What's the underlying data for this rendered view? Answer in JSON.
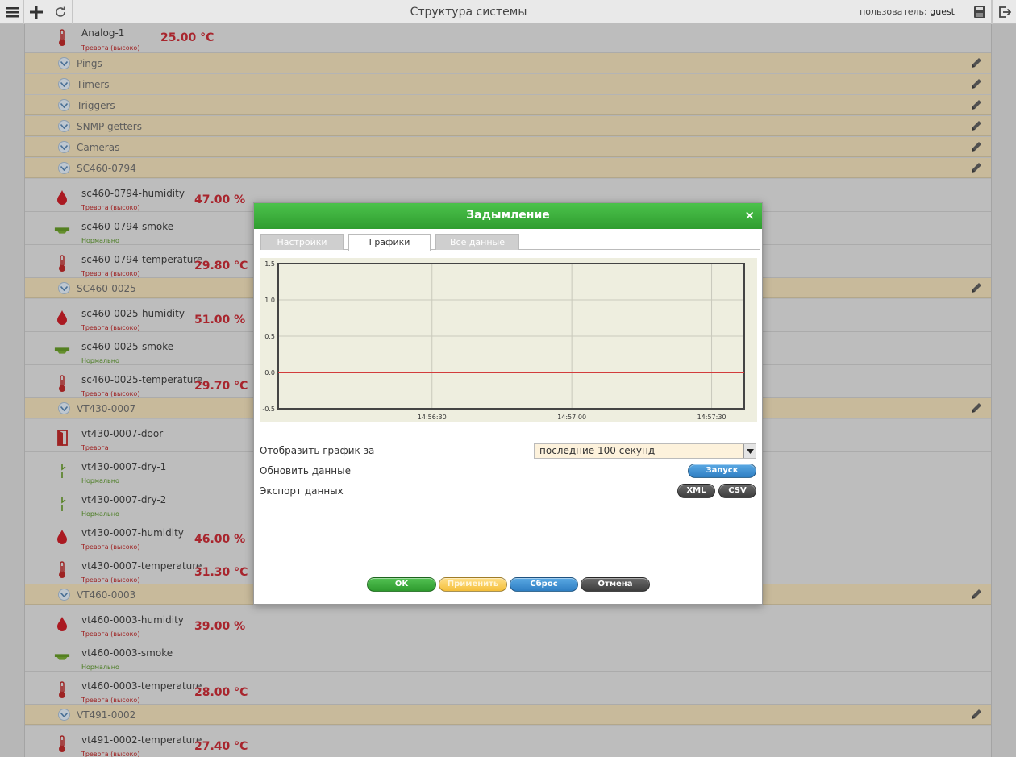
{
  "topbar": {
    "title": "Структура системы",
    "user_label": "пользователь:",
    "user_name": "guest"
  },
  "list": [
    {
      "kind": "sensor",
      "icon": "thermometer-icon",
      "name": "Analog-1",
      "state": "Тревога (высоко)",
      "state_kind": "alarm",
      "value": "25.00 °C"
    },
    {
      "kind": "group",
      "name": "Pings"
    },
    {
      "kind": "group",
      "name": "Timers"
    },
    {
      "kind": "group",
      "name": "Triggers"
    },
    {
      "kind": "group",
      "name": "SNMP getters"
    },
    {
      "kind": "group",
      "name": "Cameras"
    },
    {
      "kind": "group",
      "name": "SC460-0794"
    },
    {
      "kind": "sensor",
      "icon": "humidity-drop-icon",
      "name": "sc460-0794-humidity",
      "state": "Тревога (высоко)",
      "state_kind": "alarm",
      "value": "47.00 %"
    },
    {
      "kind": "sensor",
      "icon": "smoke-detector-icon",
      "name": "sc460-0794-smoke",
      "state": "Нормально",
      "state_kind": "ok",
      "value": ""
    },
    {
      "kind": "sensor",
      "icon": "thermometer-icon",
      "name": "sc460-0794-temperature",
      "state": "Тревога (высоко)",
      "state_kind": "alarm",
      "value": "29.80 °C"
    },
    {
      "kind": "group",
      "name": "SC460-0025"
    },
    {
      "kind": "sensor",
      "icon": "humidity-drop-icon",
      "name": "sc460-0025-humidity",
      "state": "Тревога (высоко)",
      "state_kind": "alarm",
      "value": "51.00 %"
    },
    {
      "kind": "sensor",
      "icon": "smoke-detector-icon",
      "name": "sc460-0025-smoke",
      "state": "Нормально",
      "state_kind": "ok",
      "value": ""
    },
    {
      "kind": "sensor",
      "icon": "thermometer-icon",
      "name": "sc460-0025-temperature",
      "state": "Тревога (высоко)",
      "state_kind": "alarm",
      "value": "29.70 °C"
    },
    {
      "kind": "group",
      "name": "VT430-0007"
    },
    {
      "kind": "sensor",
      "icon": "door-icon",
      "name": "vt430-0007-door",
      "state": "Тревога",
      "state_kind": "alarm",
      "value": ""
    },
    {
      "kind": "sensor",
      "icon": "dry-contact-icon",
      "name": "vt430-0007-dry-1",
      "state": "Нормально",
      "state_kind": "ok",
      "value": ""
    },
    {
      "kind": "sensor",
      "icon": "dry-contact-icon",
      "name": "vt430-0007-dry-2",
      "state": "Нормально",
      "state_kind": "ok",
      "value": ""
    },
    {
      "kind": "sensor",
      "icon": "humidity-drop-icon",
      "name": "vt430-0007-humidity",
      "state": "Тревога (высоко)",
      "state_kind": "alarm",
      "value": "46.00 %"
    },
    {
      "kind": "sensor",
      "icon": "thermometer-icon",
      "name": "vt430-0007-temperature",
      "state": "Тревога (высоко)",
      "state_kind": "alarm",
      "value": "31.30 °C"
    },
    {
      "kind": "group",
      "name": "VT460-0003"
    },
    {
      "kind": "sensor",
      "icon": "humidity-drop-icon",
      "name": "vt460-0003-humidity",
      "state": "Тревога (высоко)",
      "state_kind": "alarm",
      "value": "39.00 %"
    },
    {
      "kind": "sensor",
      "icon": "smoke-detector-icon",
      "name": "vt460-0003-smoke",
      "state": "Нормально",
      "state_kind": "ok",
      "value": ""
    },
    {
      "kind": "sensor",
      "icon": "thermometer-icon",
      "name": "vt460-0003-temperature",
      "state": "Тревога (высоко)",
      "state_kind": "alarm",
      "value": "28.00 °C"
    },
    {
      "kind": "group",
      "name": "VT491-0002"
    },
    {
      "kind": "sensor",
      "icon": "thermometer-icon",
      "name": "vt491-0002-temperature",
      "state": "Тревога (высоко)",
      "state_kind": "alarm",
      "value": "27.40 °C"
    }
  ],
  "dialog": {
    "title": "Задымление",
    "close_glyph": "×",
    "tabs": [
      "Настройки",
      "Графики",
      "Все данные"
    ],
    "active_tab": "Графики",
    "show_label": "Отобразить график за",
    "period_value": "последние 100 секунд",
    "refresh_label": "Обновить данные",
    "run_button": "Запуск",
    "export_label": "Экспорт данных",
    "xml_button": "XML",
    "csv_button": "CSV",
    "ok_button": "OK",
    "apply_button": "Применить",
    "reset_button": "Сброс",
    "cancel_button": "Отмена"
  },
  "chart_data": {
    "type": "line",
    "title": "",
    "xlabel": "",
    "ylabel": "",
    "y_ticks": [
      "1.5",
      "1.0",
      "0.5",
      "0.0",
      "-0.5"
    ],
    "ylim": [
      -0.5,
      1.5
    ],
    "x_ticks": [
      "14:56:30",
      "14:57:00",
      "14:57:30"
    ],
    "x": [
      "14:55:57",
      "14:57:37"
    ],
    "series": [
      {
        "values": [
          0,
          0
        ],
        "color": "#d23c3c"
      }
    ],
    "grid": true,
    "background": "#eeeedf"
  }
}
